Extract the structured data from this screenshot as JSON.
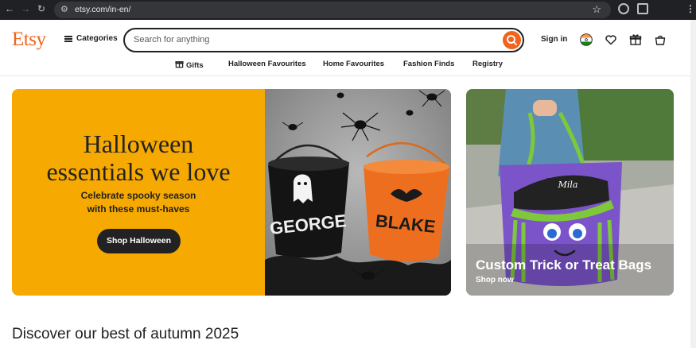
{
  "browser": {
    "url": "etsy.com/in-en/"
  },
  "header": {
    "logo": "Etsy",
    "categories_label": "Categories",
    "search_placeholder": "Search for anything",
    "signin_label": "Sign in"
  },
  "subnav": {
    "items": [
      "Gifts",
      "Halloween Favourites",
      "Home Favourites",
      "Fashion Finds",
      "Registry"
    ]
  },
  "hero": {
    "title_line1": "Halloween",
    "title_line2": "essentials we love",
    "subtitle_line1": "Celebrate spooky season",
    "subtitle_line2": "with these must-haves",
    "button_label": "Shop Halloween",
    "bucket_left_name": "GEORGE",
    "bucket_right_name": "BLAKE"
  },
  "side_card": {
    "title": "Custom Trick or Treat Bags",
    "link": "Shop now",
    "bag_name": "Mila"
  },
  "section_title": "Discover our best of autumn 2025",
  "colors": {
    "brand": "#f1641e",
    "hero_yellow": "#f6a900",
    "dark": "#222222"
  }
}
